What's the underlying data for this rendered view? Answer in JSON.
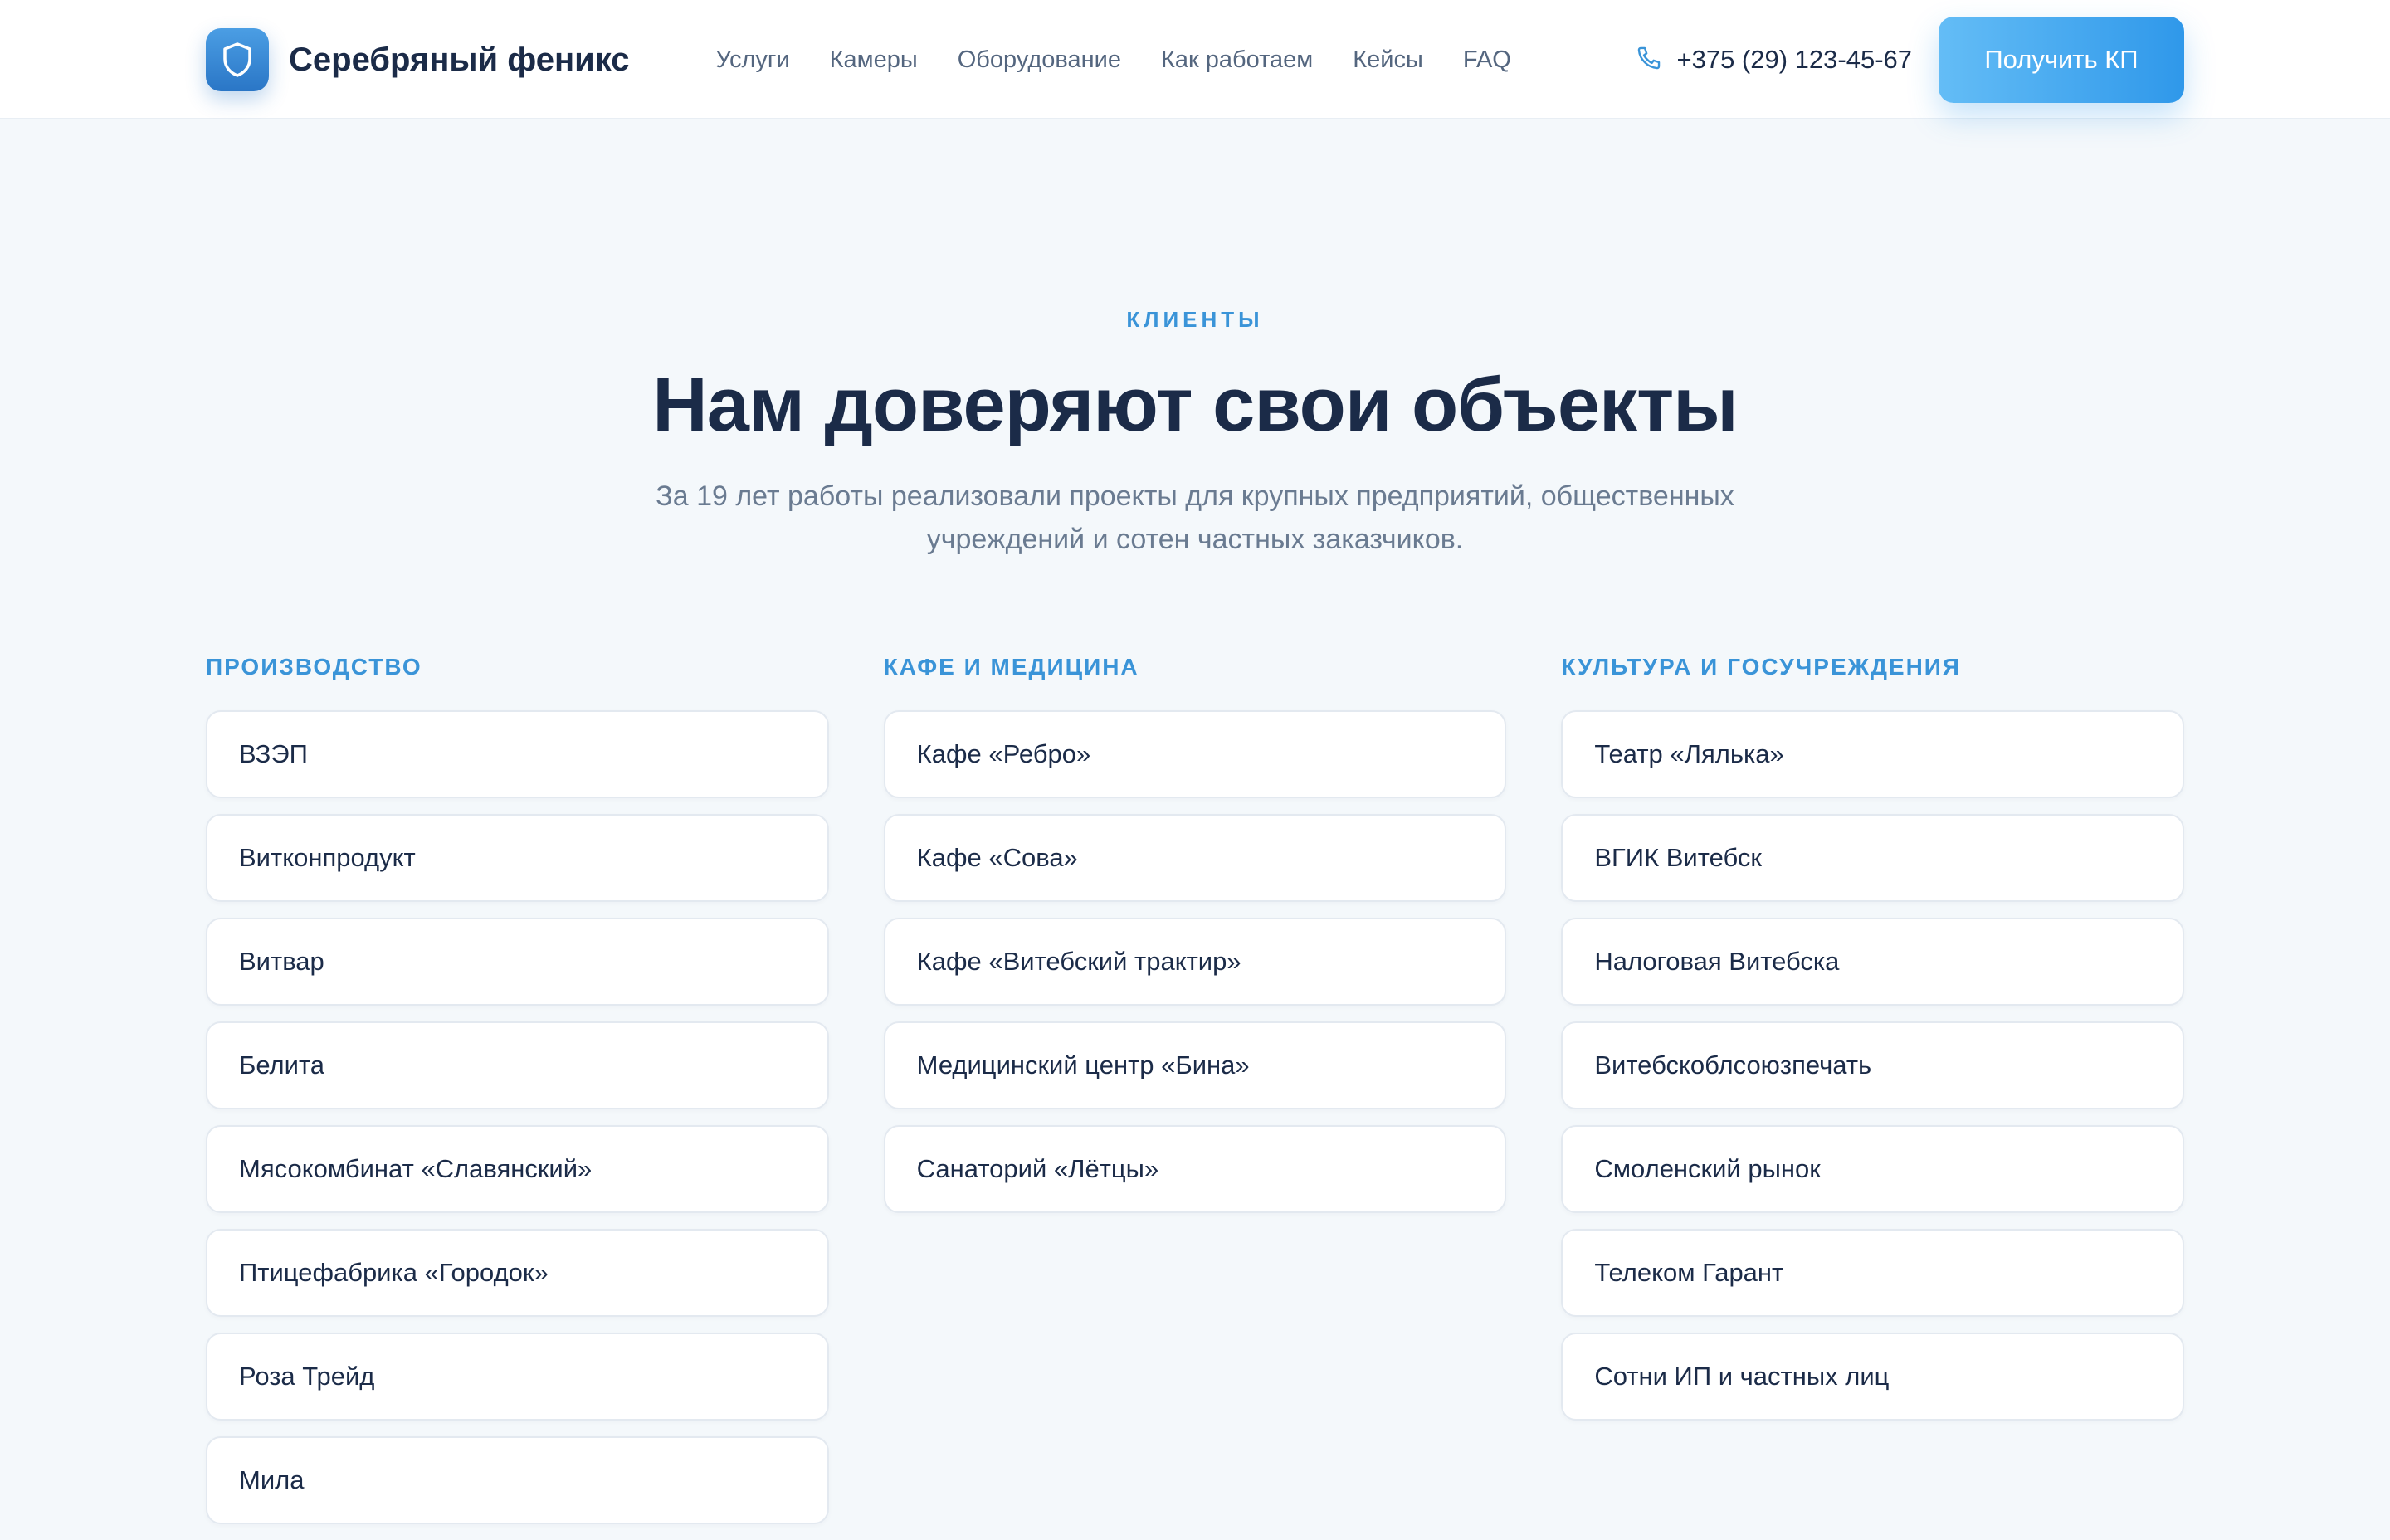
{
  "header": {
    "logo_text": "Серебряный феникс",
    "nav": [
      "Услуги",
      "Камеры",
      "Оборудование",
      "Как работаем",
      "Кейсы",
      "FAQ"
    ],
    "phone": "+375 (29) 123-45-67",
    "cta_label": "Получить КП"
  },
  "section": {
    "eyebrow": "КЛИЕНТЫ",
    "title": "Нам доверяют свои объекты",
    "subtitle": "За 19 лет работы реализовали проекты для крупных предприятий, общественных учреждений и сотен частных заказчиков."
  },
  "columns": [
    {
      "heading": "ПРОИЗВОДСТВО",
      "items": [
        "ВЗЭП",
        "Витконпродукт",
        "Витвар",
        "Белита",
        "Мясокомбинат «Славянский»",
        "Птицефабрика «Городок»",
        "Роза Трейд",
        "Мила"
      ]
    },
    {
      "heading": "КАФЕ И МЕДИЦИНА",
      "items": [
        "Кафе «Ребро»",
        "Кафе «Сова»",
        "Кафе «Витебский трактир»",
        "Медицинский центр «Бина»",
        "Санаторий «Лётцы»"
      ]
    },
    {
      "heading": "КУЛЬТУРА И ГОСУЧРЕЖДЕНИЯ",
      "items": [
        "Театр «Лялька»",
        "ВГИК Витебск",
        "Налоговая Витебска",
        "Витебскоблсоюзпечать",
        "Смоленский рынок",
        "Телеком Гарант",
        "Сотни ИП и частных лиц"
      ]
    }
  ],
  "colors": {
    "accent": "#3a94d8",
    "text": "#1b2b48",
    "muted": "#6a7b91",
    "background": "#f4f8fb"
  },
  "icons": {
    "logo": "shield-icon",
    "phone": "phone-icon"
  }
}
